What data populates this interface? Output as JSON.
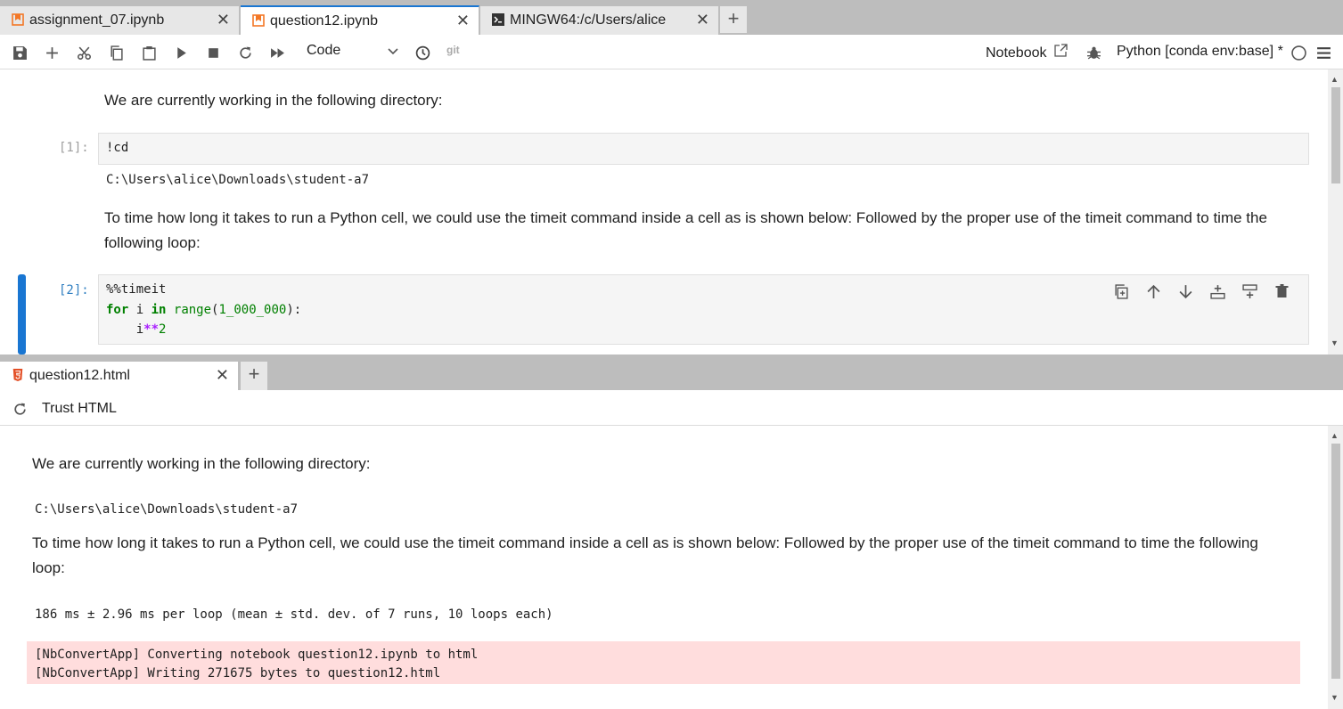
{
  "tabs": [
    {
      "label": "assignment_07.ipynb",
      "icon": "notebook-icon"
    },
    {
      "label": "question12.ipynb",
      "icon": "notebook-icon"
    },
    {
      "label": "MINGW64:/c/Users/alice",
      "icon": "terminal-icon"
    }
  ],
  "toolbar": {
    "cell_type": "Code",
    "git_label": "git",
    "notebook_label": "Notebook",
    "kernel": "Python [conda env:base] *"
  },
  "notebook": {
    "md1": "We are currently working in the following directory:",
    "cell1": {
      "prompt": "[1]:",
      "code": "!cd",
      "output": "C:\\Users\\alice\\Downloads\\student-a7"
    },
    "md2": "To time how long it takes to run a Python cell, we could use the timeit command inside a cell as is shown below: Followed by the proper use of the timeit command to time the following loop:",
    "cell2": {
      "prompt": "[2]:",
      "line1": "%%timeit",
      "kw_for": "for",
      "var_i": " i ",
      "kw_in": "in",
      "fn_range": "range",
      "paren_open": "(",
      "num_arg": "1_000_000",
      "paren_close": "):",
      "indent_i": "    i",
      "op_pow": "**",
      "num_2": "2"
    }
  },
  "html_viewer": {
    "tab_label": "question12.html",
    "tab_icon": "html5-icon",
    "trust_label": "Trust HTML",
    "md1": "We are currently working in the following directory:",
    "output1": "C:\\Users\\alice\\Downloads\\student-a7",
    "md2": "To time how long it takes to run a Python cell, we could use the timeit command inside a cell as is shown below: Followed by the proper use of the timeit command to time the following loop:",
    "timeit_output": "186 ms ± 2.96 ms per loop (mean ± std. dev. of 7 runs, 10 loops each)",
    "stderr_line1": "[NbConvertApp] Converting notebook question12.ipynb to html",
    "stderr_line2": "[NbConvertApp] Writing 271675 bytes to question12.html"
  },
  "colors": {
    "accent": "#1976d2",
    "active_cell_bar": "#1976d2",
    "stderr_bg": "#ffdddd",
    "notebook_icon": "#f37726"
  }
}
